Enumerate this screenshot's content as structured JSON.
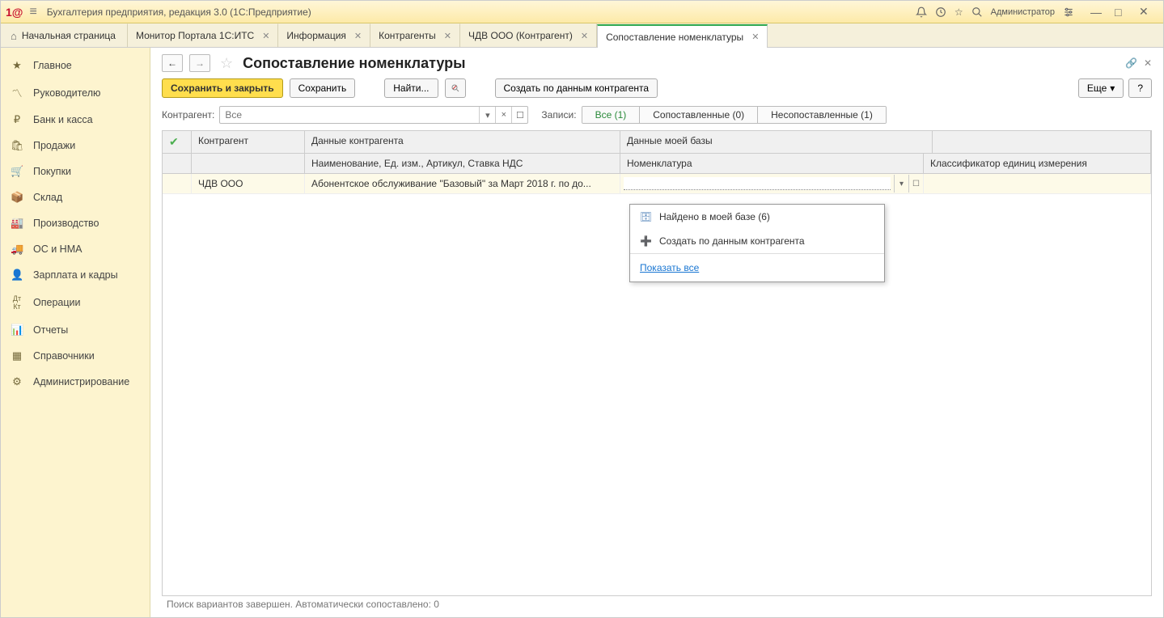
{
  "titlebar": {
    "app_title": "Бухгалтерия предприятия, редакция 3.0  (1С:Предприятие)",
    "user": "Администратор"
  },
  "tabs": [
    {
      "label": "Начальная страница",
      "closable": false,
      "home": true
    },
    {
      "label": "Монитор Портала 1С:ИТС",
      "closable": true
    },
    {
      "label": "Информация",
      "closable": true
    },
    {
      "label": "Контрагенты",
      "closable": true
    },
    {
      "label": "ЧДВ ООО (Контрагент)",
      "closable": true
    },
    {
      "label": "Сопоставление номенклатуры",
      "closable": true,
      "active": true
    }
  ],
  "sidebar": {
    "items": [
      {
        "icon": "star",
        "label": "Главное"
      },
      {
        "icon": "chart",
        "label": "Руководителю"
      },
      {
        "icon": "ruble",
        "label": "Банк и касса"
      },
      {
        "icon": "cart",
        "label": "Продажи"
      },
      {
        "icon": "basket",
        "label": "Покупки"
      },
      {
        "icon": "box",
        "label": "Склад"
      },
      {
        "icon": "factory",
        "label": "Производство"
      },
      {
        "icon": "truck",
        "label": "ОС и НМА"
      },
      {
        "icon": "person",
        "label": "Зарплата и кадры"
      },
      {
        "icon": "dk",
        "label": "Операции"
      },
      {
        "icon": "bars",
        "label": "Отчеты"
      },
      {
        "icon": "book",
        "label": "Справочники"
      },
      {
        "icon": "gear",
        "label": "Администрирование"
      }
    ]
  },
  "page": {
    "title": "Сопоставление номенклатуры",
    "toolbar": {
      "save_close": "Сохранить и закрыть",
      "save": "Сохранить",
      "find": "Найти...",
      "create": "Создать по данным контрагента",
      "more": "Еще",
      "help": "?"
    },
    "filter": {
      "label_kontr": "Контрагент:",
      "placeholder": "Все",
      "label_zapisi": "Записи:",
      "seg_all": "Все (1)",
      "seg_matched": "Сопоставленные (0)",
      "seg_unmatched": "Несопоставленные (1)"
    },
    "table": {
      "h_kontr": "Контрагент",
      "h_data_kontr": "Данные контрагента",
      "h_data_base": "Данные моей базы",
      "h_naim": "Наименование, Ед. изм., Артикул, Ставка НДС",
      "h_nomen": "Номенклатура",
      "h_klass": "Классификатор единиц измерения",
      "rows": [
        {
          "kontr": "ЧДВ ООО",
          "data": "Абонентское обслуживание \"Базовый\" за Март 2018 г. по до..."
        }
      ]
    },
    "dropdown": {
      "found": "Найдено в моей базе (6)",
      "create": "Создать по данным контрагента",
      "show_all": "Показать все"
    },
    "status": "Поиск вариантов завершен. Автоматически сопоставлено: 0"
  }
}
